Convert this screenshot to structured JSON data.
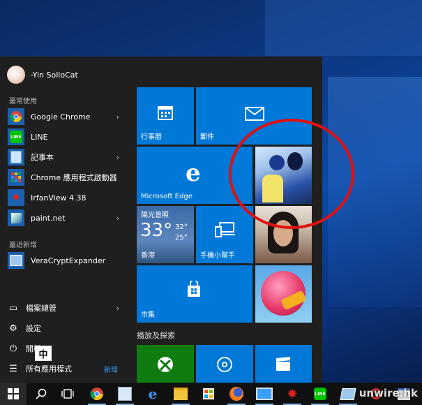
{
  "user": {
    "name": "-Yin SolloCat"
  },
  "sections": {
    "frequent": "最常使用",
    "recent": "最近新增"
  },
  "frequent_apps": [
    {
      "label": "Google Chrome",
      "icon": "chrome-icon",
      "has_arrow": true
    },
    {
      "label": "LINE",
      "icon": "line-icon",
      "has_arrow": false
    },
    {
      "label": "記事本",
      "icon": "notepad-icon",
      "has_arrow": true
    },
    {
      "label": "Chrome 應用程式啟動器",
      "icon": "chrome-app-launcher-icon",
      "has_arrow": false
    },
    {
      "label": "IrfanView 4.38",
      "icon": "irfanview-icon",
      "has_arrow": false
    },
    {
      "label": "paint.net",
      "icon": "paintnet-icon",
      "has_arrow": true
    }
  ],
  "recent_apps": [
    {
      "label": "VeraCryptExpander",
      "icon": "veracrypt-icon"
    }
  ],
  "system": {
    "file_explorer": "檔案總管",
    "settings": "設定",
    "power": "開機",
    "all_apps": "所有應用程式",
    "new_badge": "新增"
  },
  "ime_indicator": "中",
  "tiles": {
    "calendar": "行事曆",
    "mail": "郵件",
    "edge": "Microsoft Edge",
    "weather": {
      "condition": "陽光普照",
      "temp": "33°",
      "high": "32°",
      "low": "25°",
      "city": "香港"
    },
    "phone": "手機小幫手",
    "store": "市集",
    "group2_title": "播放及探索"
  },
  "watermark": "unwire.hk",
  "colors": {
    "tile_blue": "#0078d7",
    "annotation_red": "#e01010",
    "xbox_green": "#107c10"
  }
}
